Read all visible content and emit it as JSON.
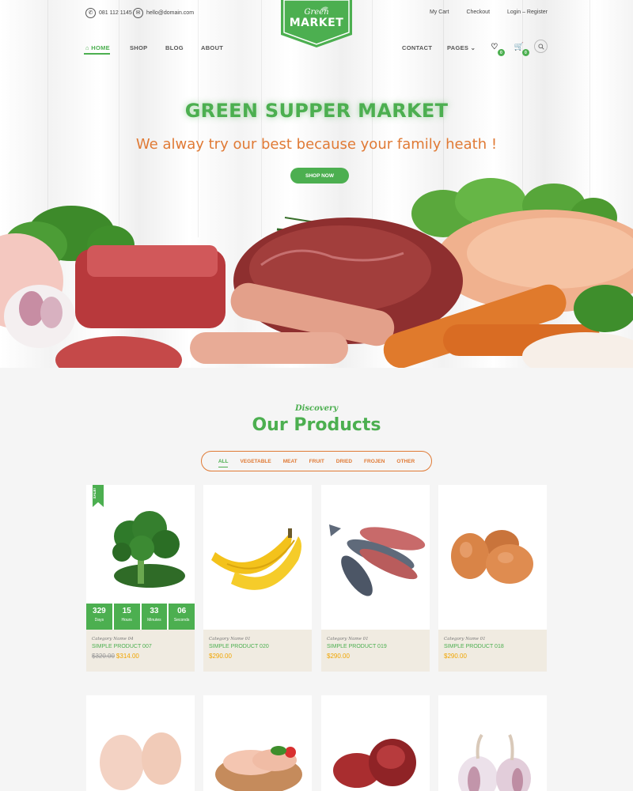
{
  "topbar": {
    "phone": "081 112 1145",
    "email": "hello@domain.com",
    "links": [
      "My Cart",
      "Checkout",
      "Login – Register"
    ]
  },
  "logo": {
    "line1": "Green",
    "line2": "MARKET"
  },
  "nav": {
    "home": "HOME",
    "shop": "SHOP",
    "blog": "BLOG",
    "about": "ABOUT",
    "contact": "CONTACT",
    "pages": "PAGES",
    "wishlist_count": "0",
    "cart_count": "0"
  },
  "hero": {
    "title": "GREEN SUPPER MARKET",
    "subtitle": "We alway try our best because your family heath !",
    "button": "SHOP NOW"
  },
  "products": {
    "kicker": "Discovery",
    "title": "Our Products",
    "filters": [
      "ALL",
      "VEGETABLE",
      "MEAT",
      "FRUIT",
      "DRIED",
      "FROJEN",
      "OTHER"
    ],
    "items": [
      {
        "category": "Category Name 04",
        "name": "SIMPLE PRODUCT 007",
        "old_price": "$320.00",
        "price": "$314.00",
        "sale": "SALE!",
        "countdown": [
          {
            "value": "329",
            "label": "Days"
          },
          {
            "value": "15",
            "label": "Hours"
          },
          {
            "value": "33",
            "label": "Minutes"
          },
          {
            "value": "06",
            "label": "Seconds"
          }
        ]
      },
      {
        "category": "Category Name 01",
        "name": "SIMPLE PRODUCT 020",
        "price": "$290.00"
      },
      {
        "category": "Category Name 01",
        "name": "SIMPLE PRODUCT 019",
        "price": "$290.00"
      },
      {
        "category": "Category Name 01",
        "name": "SIMPLE PRODUCT 018",
        "price": "$290.00"
      }
    ]
  },
  "colors": {
    "green": "#4caf50",
    "orange": "#e07a35",
    "price": "#f0a500",
    "info_bg": "#f0ebe1"
  }
}
